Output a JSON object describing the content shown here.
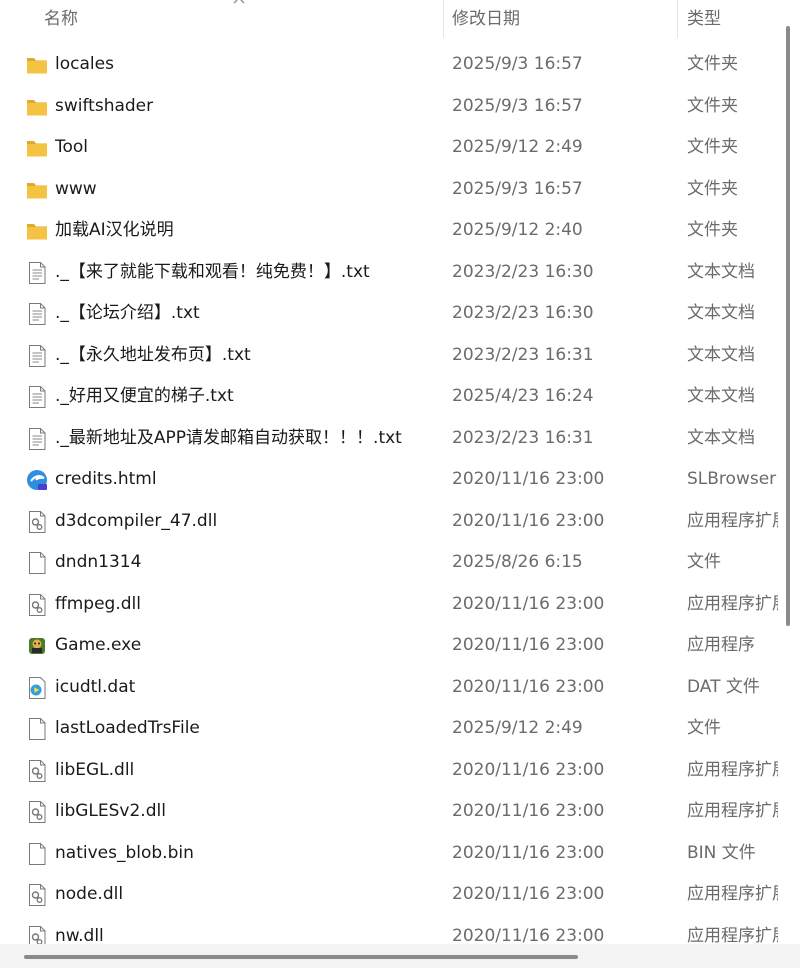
{
  "header": {
    "name_label": "名称",
    "date_label": "修改日期",
    "type_label": "类型"
  },
  "files": [
    {
      "icon": "folder-icon",
      "name": "locales",
      "date": "2025/9/3 16:57",
      "type": "文件夹"
    },
    {
      "icon": "folder-icon",
      "name": "swiftshader",
      "date": "2025/9/3 16:57",
      "type": "文件夹"
    },
    {
      "icon": "folder-icon",
      "name": "Tool",
      "date": "2025/9/12 2:49",
      "type": "文件夹"
    },
    {
      "icon": "folder-icon",
      "name": "www",
      "date": "2025/9/3 16:57",
      "type": "文件夹"
    },
    {
      "icon": "folder-icon",
      "name": "加载AI汉化说明",
      "date": "2025/9/12 2:40",
      "type": "文件夹"
    },
    {
      "icon": "text-file-icon",
      "name": "._【来了就能下载和观看！纯免费！】.txt",
      "date": "2023/2/23 16:30",
      "type": "文本文档"
    },
    {
      "icon": "text-file-icon",
      "name": "._【论坛介绍】.txt",
      "date": "2023/2/23 16:30",
      "type": "文本文档"
    },
    {
      "icon": "text-file-icon",
      "name": "._【永久地址发布页】.txt",
      "date": "2023/2/23 16:31",
      "type": "文本文档"
    },
    {
      "icon": "text-file-icon",
      "name": "._好用又便宜的梯子.txt",
      "date": "2025/4/23 16:24",
      "type": "文本文档"
    },
    {
      "icon": "text-file-icon",
      "name": "._最新地址及APP请发邮箱自动获取！！！.txt",
      "date": "2023/2/23 16:31",
      "type": "文本文档"
    },
    {
      "icon": "browser-icon",
      "name": "credits.html",
      "date": "2020/11/16 23:00",
      "type": "SLBrowser"
    },
    {
      "icon": "dll-file-icon",
      "name": "d3dcompiler_47.dll",
      "date": "2020/11/16 23:00",
      "type": "应用程序扩展"
    },
    {
      "icon": "blank-file-icon",
      "name": "dndn1314",
      "date": "2025/8/26 6:15",
      "type": "文件"
    },
    {
      "icon": "dll-file-icon",
      "name": "ffmpeg.dll",
      "date": "2020/11/16 23:00",
      "type": "应用程序扩展"
    },
    {
      "icon": "game-exe-icon",
      "name": "Game.exe",
      "date": "2020/11/16 23:00",
      "type": "应用程序"
    },
    {
      "icon": "media-file-icon",
      "name": "icudtl.dat",
      "date": "2020/11/16 23:00",
      "type": "DAT 文件"
    },
    {
      "icon": "blank-file-icon",
      "name": "lastLoadedTrsFile",
      "date": "2025/9/12 2:49",
      "type": "文件"
    },
    {
      "icon": "dll-file-icon",
      "name": "libEGL.dll",
      "date": "2020/11/16 23:00",
      "type": "应用程序扩展"
    },
    {
      "icon": "dll-file-icon",
      "name": "libGLESv2.dll",
      "date": "2020/11/16 23:00",
      "type": "应用程序扩展"
    },
    {
      "icon": "blank-file-icon",
      "name": "natives_blob.bin",
      "date": "2020/11/16 23:00",
      "type": "BIN 文件"
    },
    {
      "icon": "dll-file-icon",
      "name": "node.dll",
      "date": "2020/11/16 23:00",
      "type": "应用程序扩展"
    },
    {
      "icon": "dll-file-icon",
      "name": "nw.dll",
      "date": "2020/11/16 23:00",
      "type": "应用程序扩展"
    }
  ],
  "colors": {
    "folder": "#f5c342",
    "folder_dark": "#e0a92a",
    "scroll_thumb": "#8a8a8a"
  }
}
